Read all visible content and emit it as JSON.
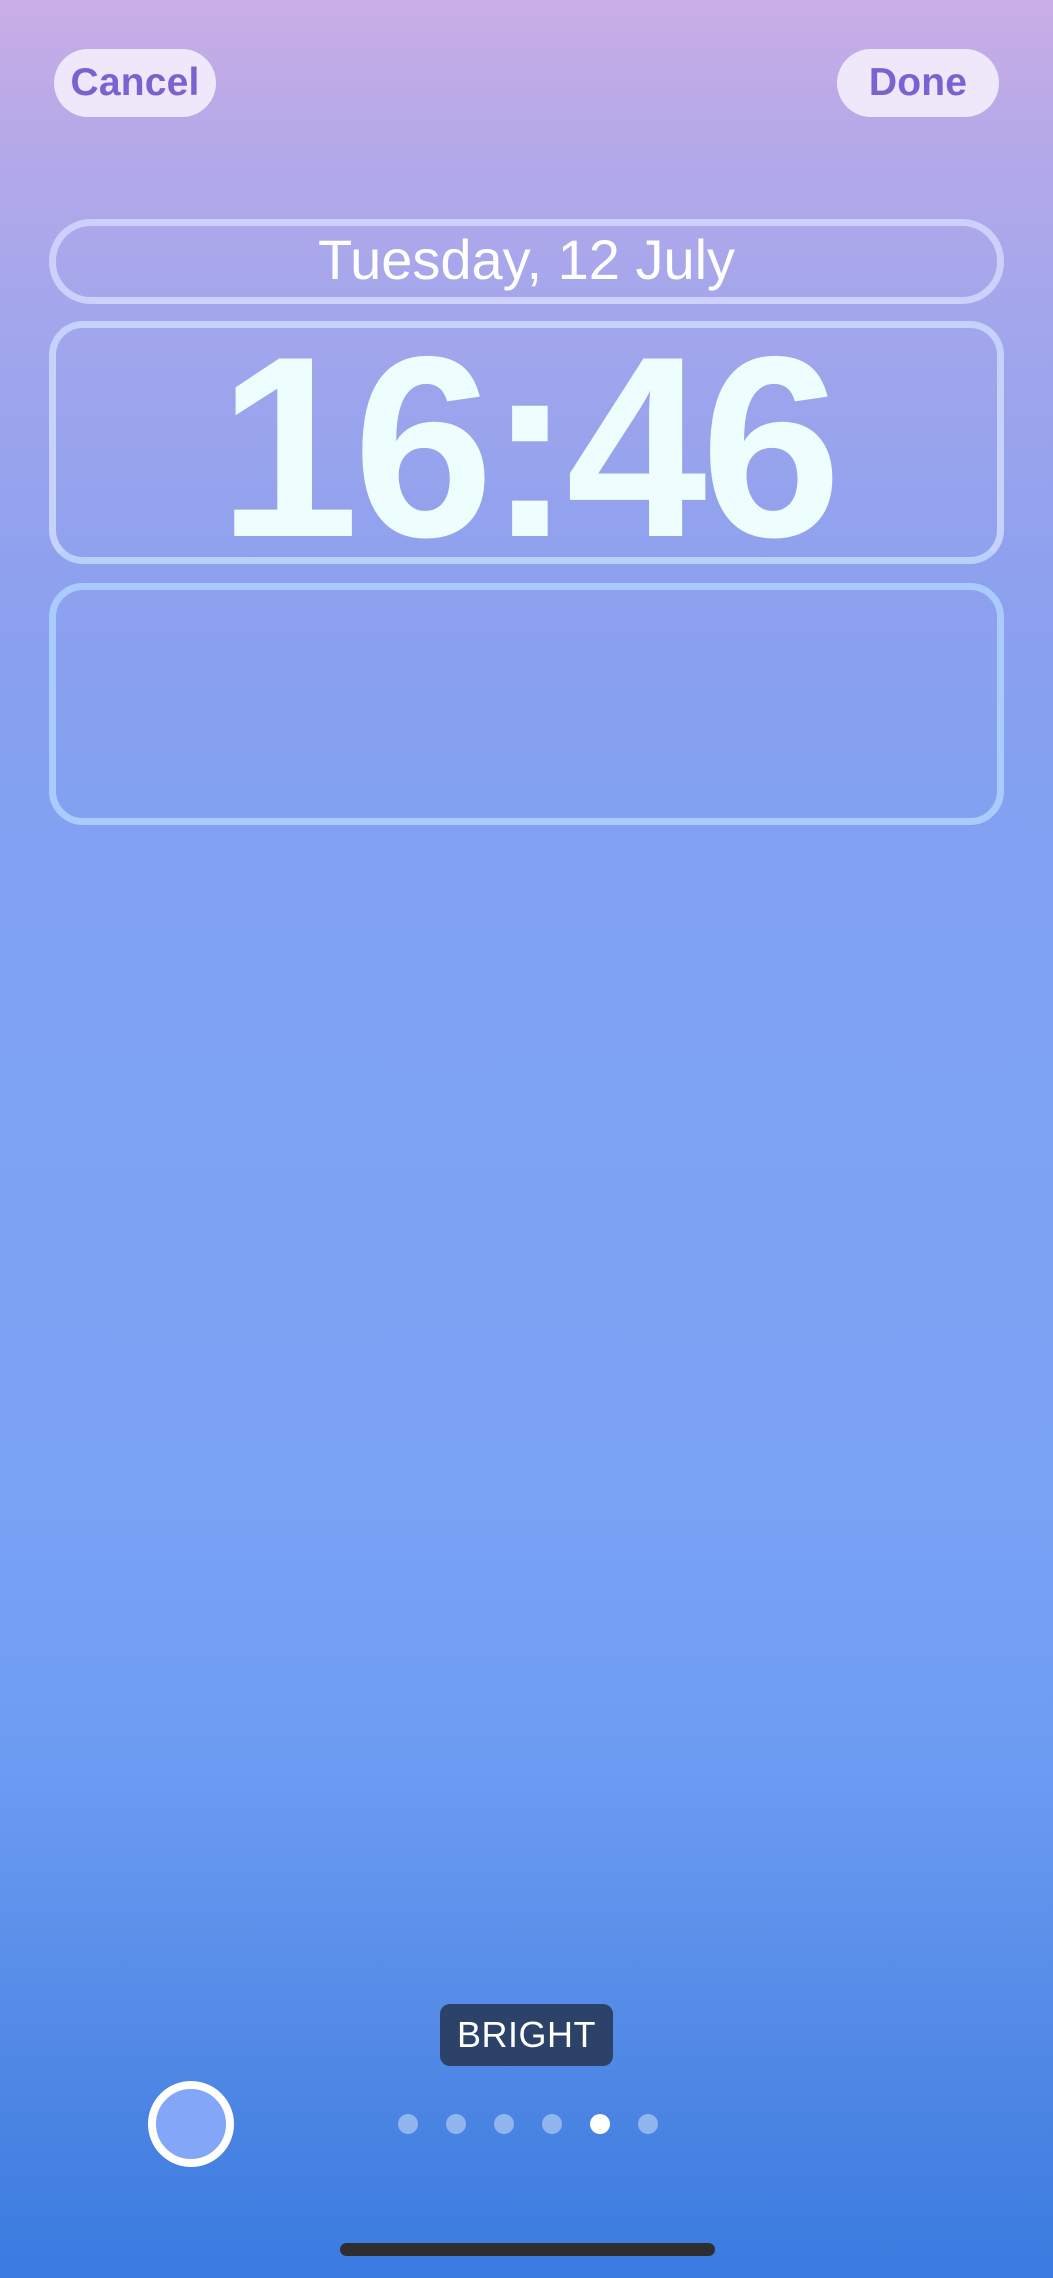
{
  "toolbar": {
    "cancel_label": "Cancel",
    "done_label": "Done"
  },
  "lock_screen": {
    "date": "Tuesday, 12 July",
    "time": "16:46",
    "widgets_empty": true
  },
  "style_picker": {
    "current_style_label": "BRIGHT",
    "swatch_color": "#84A6F8",
    "page_count": 6,
    "active_page_index": 4,
    "pages": [
      {
        "active": false
      },
      {
        "active": false
      },
      {
        "active": false
      },
      {
        "active": false
      },
      {
        "active": true
      },
      {
        "active": false
      }
    ]
  },
  "colors": {
    "button_text": "#7B62D0",
    "button_bg": "#EFE7FA",
    "label_bg": "#2C4268",
    "gradient_top": "#CAAEE6",
    "gradient_bottom": "#3A7BE0"
  }
}
